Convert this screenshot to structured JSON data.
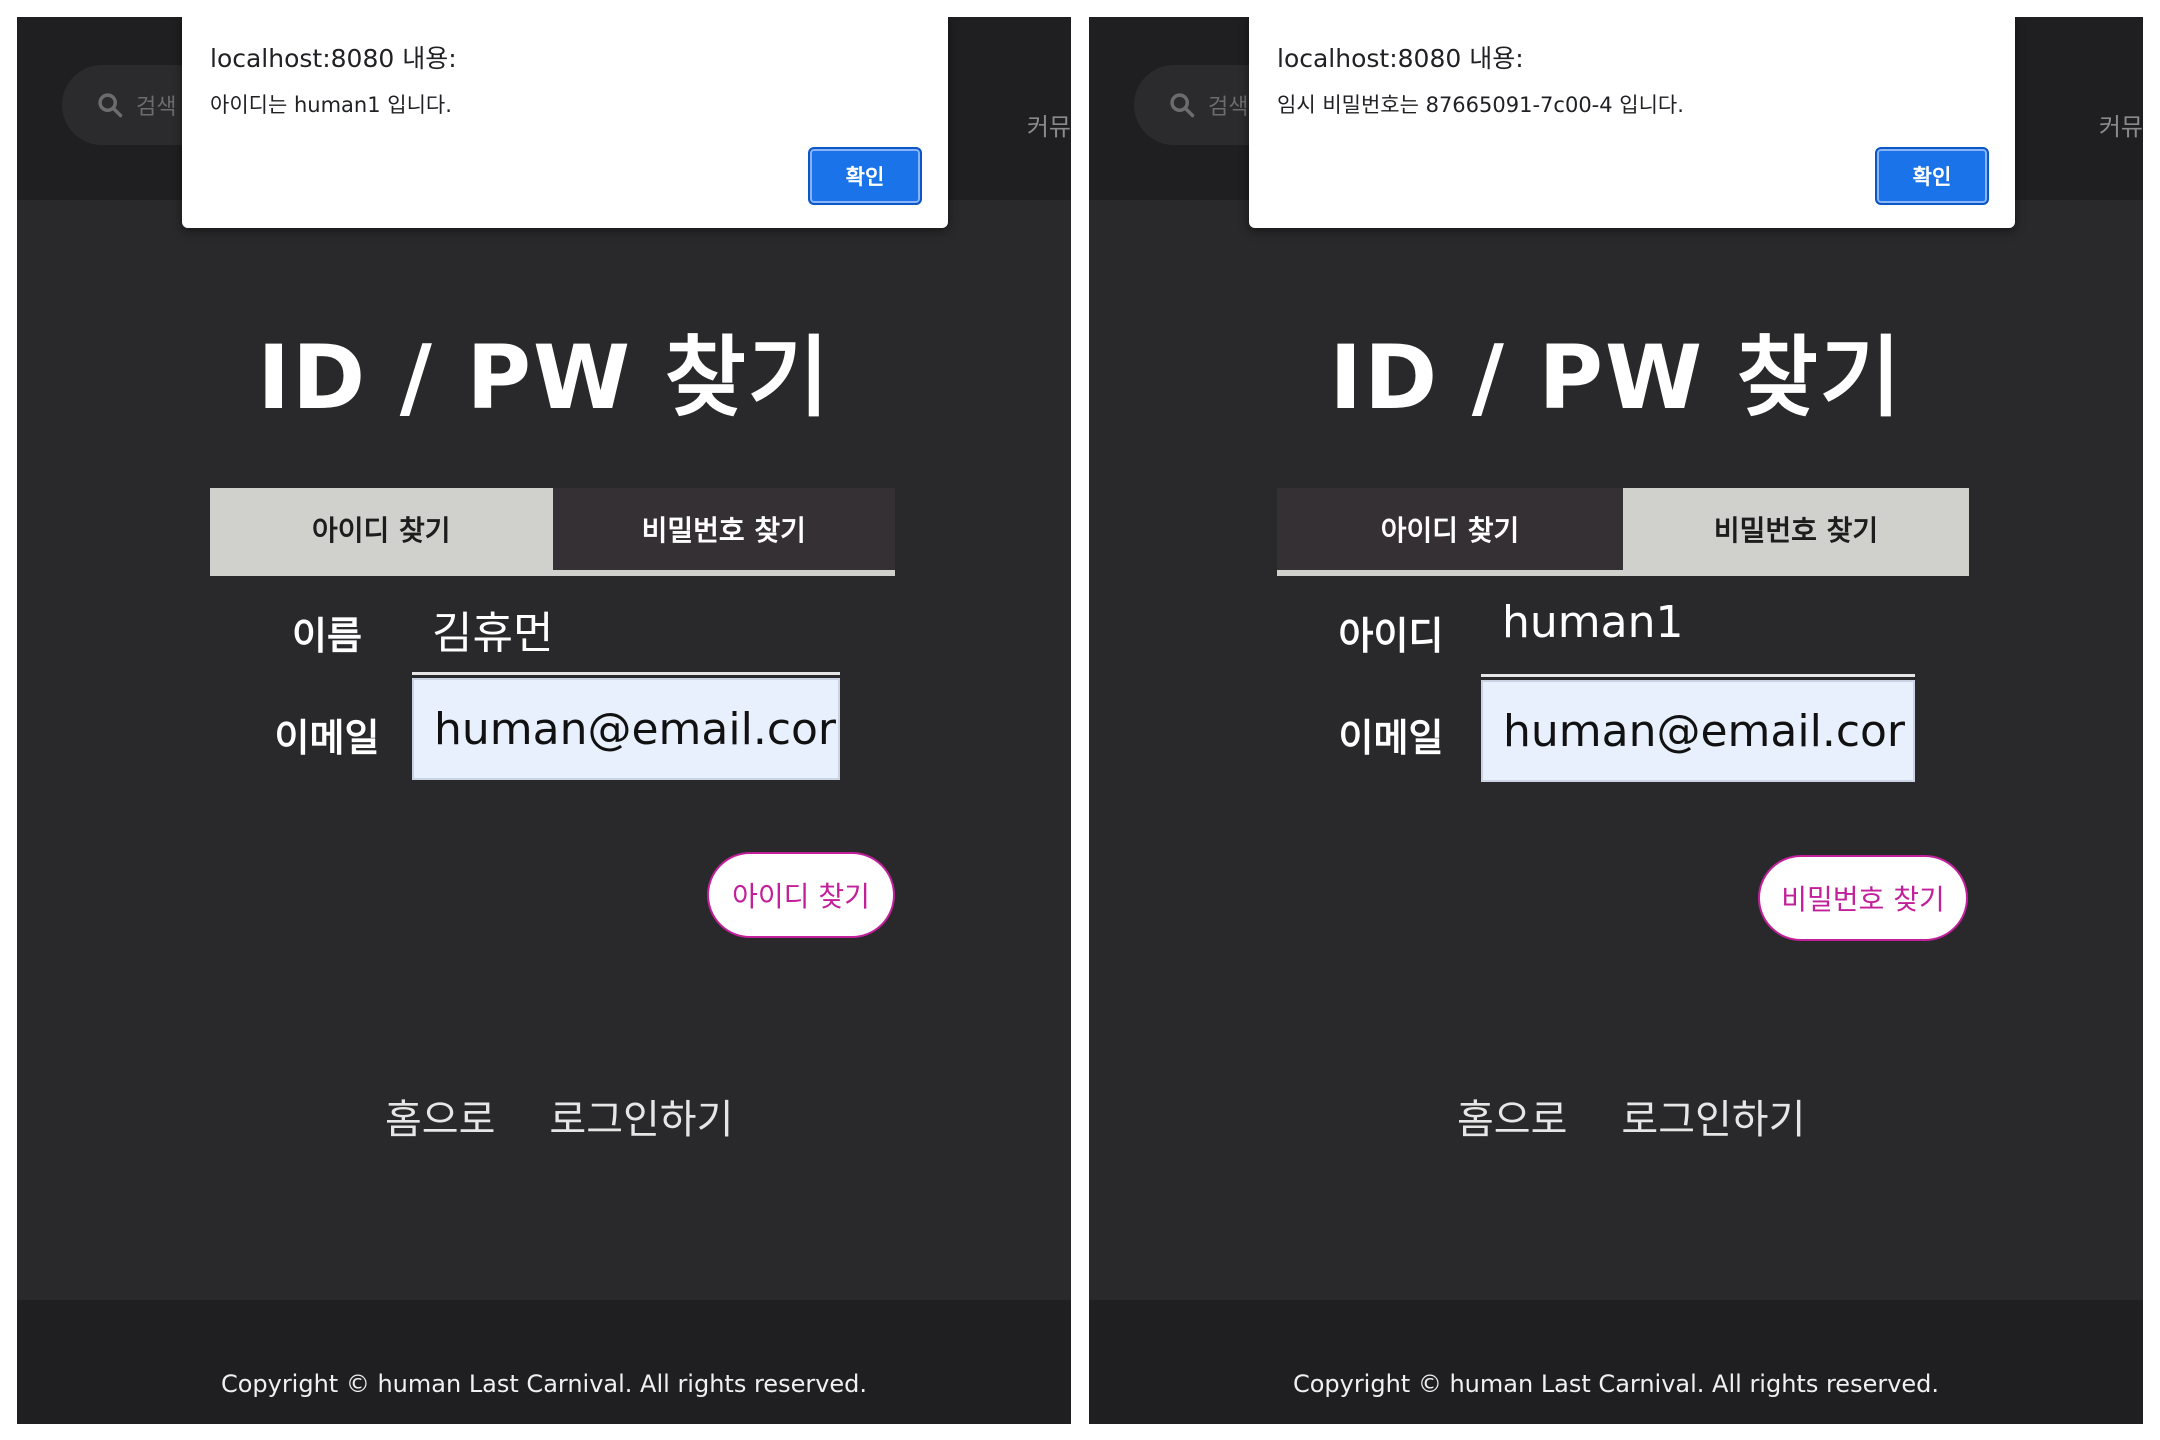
{
  "left": {
    "search_placeholder": "검색",
    "nav_partial": "커뮤",
    "dialog": {
      "title": "localhost:8080 내용:",
      "message": "아이디는 human1 입니다.",
      "ok_label": "확인"
    },
    "page_title": "ID / PW 찾기",
    "tabs": [
      {
        "label": "아이디 찾기",
        "active": true
      },
      {
        "label": "비밀번호 찾기",
        "active": false
      }
    ],
    "field1": {
      "label": "이름",
      "value": "김휴먼"
    },
    "field2": {
      "label": "이메일",
      "value": "human@email.cor"
    },
    "submit_label": "아이디 찾기",
    "links": [
      "홈으로",
      "로그인하기"
    ],
    "copyright": "Copyright © human Last Carnival. All rights reserved."
  },
  "right": {
    "search_placeholder": "검색",
    "nav_partial": "커뮤",
    "dialog": {
      "title": "localhost:8080 내용:",
      "message": "임시 비밀번호는 87665091-7c00-4 입니다.",
      "ok_label": "확인"
    },
    "page_title": "ID / PW 찾기",
    "tabs": [
      {
        "label": "아이디 찾기",
        "active": false
      },
      {
        "label": "비밀번호 찾기",
        "active": true
      }
    ],
    "field1": {
      "label": "아이디",
      "value": "human1"
    },
    "field2": {
      "label": "이메일",
      "value": "human@email.cor"
    },
    "submit_label": "비밀번호 찾기",
    "links": [
      "홈으로",
      "로그인하기"
    ],
    "copyright": "Copyright © human Last Carnival. All rights reserved."
  },
  "colors": {
    "page_bg": "#29292b",
    "topbar_bg": "#1f1f21",
    "tab_active": "#d0d0cc",
    "tab_inactive": "#353033",
    "accent_pink": "#c21f9b",
    "dialog_button": "#1a73e8",
    "autofill_bg": "#e8f0fe"
  },
  "icons": {
    "search": "search-icon"
  }
}
